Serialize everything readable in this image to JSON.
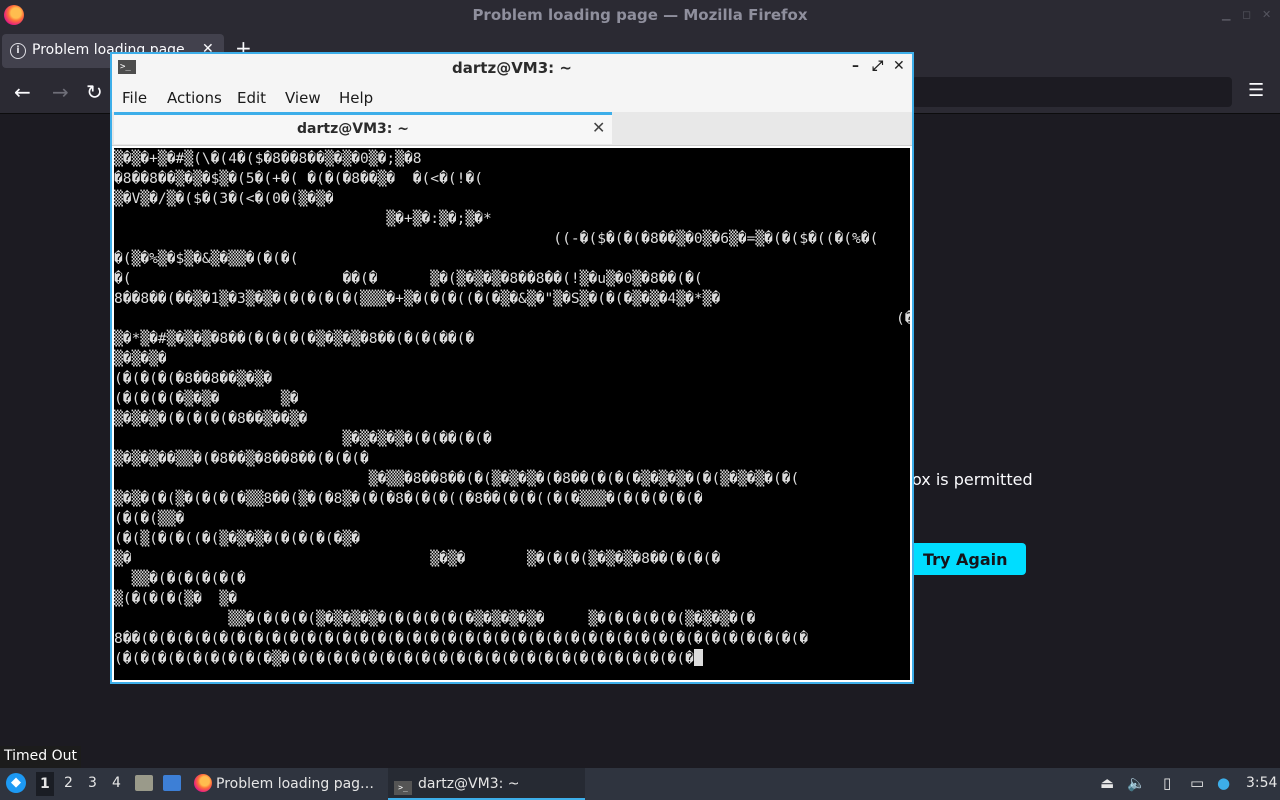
{
  "firefox": {
    "window_title": "Problem loading page — Mozilla Firefox",
    "tab_title": "Problem loading page",
    "error_text_fragment": "ox is permitted",
    "try_again_label": "Try Again"
  },
  "terminal": {
    "window_title": "dartz@VM3: ~",
    "menu": [
      "File",
      "Actions",
      "Edit",
      "View",
      "Help"
    ],
    "tab_label": "dartz@VM3: ~",
    "lines": [
      "▒�▒�+▒�#▒(\\�(4�($�8��8��▒�▒�0▒�;▒�8",
      "�8��8��▒�▒�$▒�(5�(+�( �(�(�8��▒�  �(<�(!�(",
      "▒�V▒�/▒�($�(3�(<�(0�(▒�▒�",
      "                               ▒�+▒�:▒�;▒�*",
      "                                                  ((-�($�(�(�8��▒�0▒�6▒�=▒�(�($�((�(%�(",
      "�(▒�%▒�$▒�&▒�▒▒�(�(�(",
      "�(                        ��(�      ▒�(▒�▒�▒�8��8��(!▒�u▒�0▒�8��(�(",
      "8��8��(��▒�1▒�3▒�▒�(�(�(�(�(▒▒▒�+▒�(�(�((�(�▒�&▒�\"▒�S▒�(�(�▒�▒�4▒�*▒�",
      "                                                                                         (�(�",
      "▒�*▒�#▒�▒�▒�8��(�(�(�(�▒�▒�▒�8��(�(�(��(�",
      "▒�▒�▒�",
      "(�(�(�(�8��8��▒�▒�",
      "(�(�(�(�▒�▒�       ▒�",
      "▒�▒�▒�(�(�(�(�8��▒��▒�",
      "                          ▒�▒�▒�▒�(�(��(�(�",
      "▒�▒�▒��▒▒�(�8��▒�8��8��(�(�(�",
      "                             ▒�▒▒�8��8��(�(▒�▒�▒�(�8��(�(�(�▒�▒�▒�(�(▒�▒�▒�(�(",
      "▒�▒�(�(▒�(�(�(�▒▒8��(▒�(�8▒�(�(�8�(�(�((�8��(�(�((�(�▒▒▒�(�(�(�(�(�",
      "(�(�(▒▒�",
      "(�(▒(�(�((�(▒�▒�▒�(�(�(�(�▒�",
      "▒�                                  ▒�▒�       ▒�(�(�(▒�▒�▒�8��(�(�(�",
      "  ▒▒�(�(�(�(�(�",
      "▒(�(�(�(▒�  ▒�",
      "             ▒▒�(�(�(�(▒�▒�▒�▒�(�(�(�(�(�▒�▒�▒�▒�     ▒�(�(�(�(�(▒�▒�▒�(�",
      "8��(�(�(�(�(�(�(�(�(�(�(�(�(�(�(�(�(�(�(�(�(�(�(�(�(�(�(�(�(�(�(�(�(�(�(�(�(�(�",
      "(�(�(�(�(�(�(�(�(�▒�(�(�(�(�(�(�(�(�(�(�(�(�(�(�(�(�(�(�(�(�(�(�(�"
    ]
  },
  "tooltip": "Timed Out",
  "taskbar": {
    "workspaces": [
      "1",
      "2",
      "3",
      "4"
    ],
    "active_workspace": "1",
    "tasks": [
      {
        "label": "Problem loading pag…",
        "icon": "firefox-icon"
      },
      {
        "label": "dartz@VM3: ~",
        "icon": "terminal-icon"
      }
    ],
    "clock": "3:54"
  },
  "colors": {
    "accent": "#3daee9",
    "try_again_bg": "#00ddff",
    "terminal_bg": "#000000",
    "firefox_bg": "#1c1b22"
  }
}
